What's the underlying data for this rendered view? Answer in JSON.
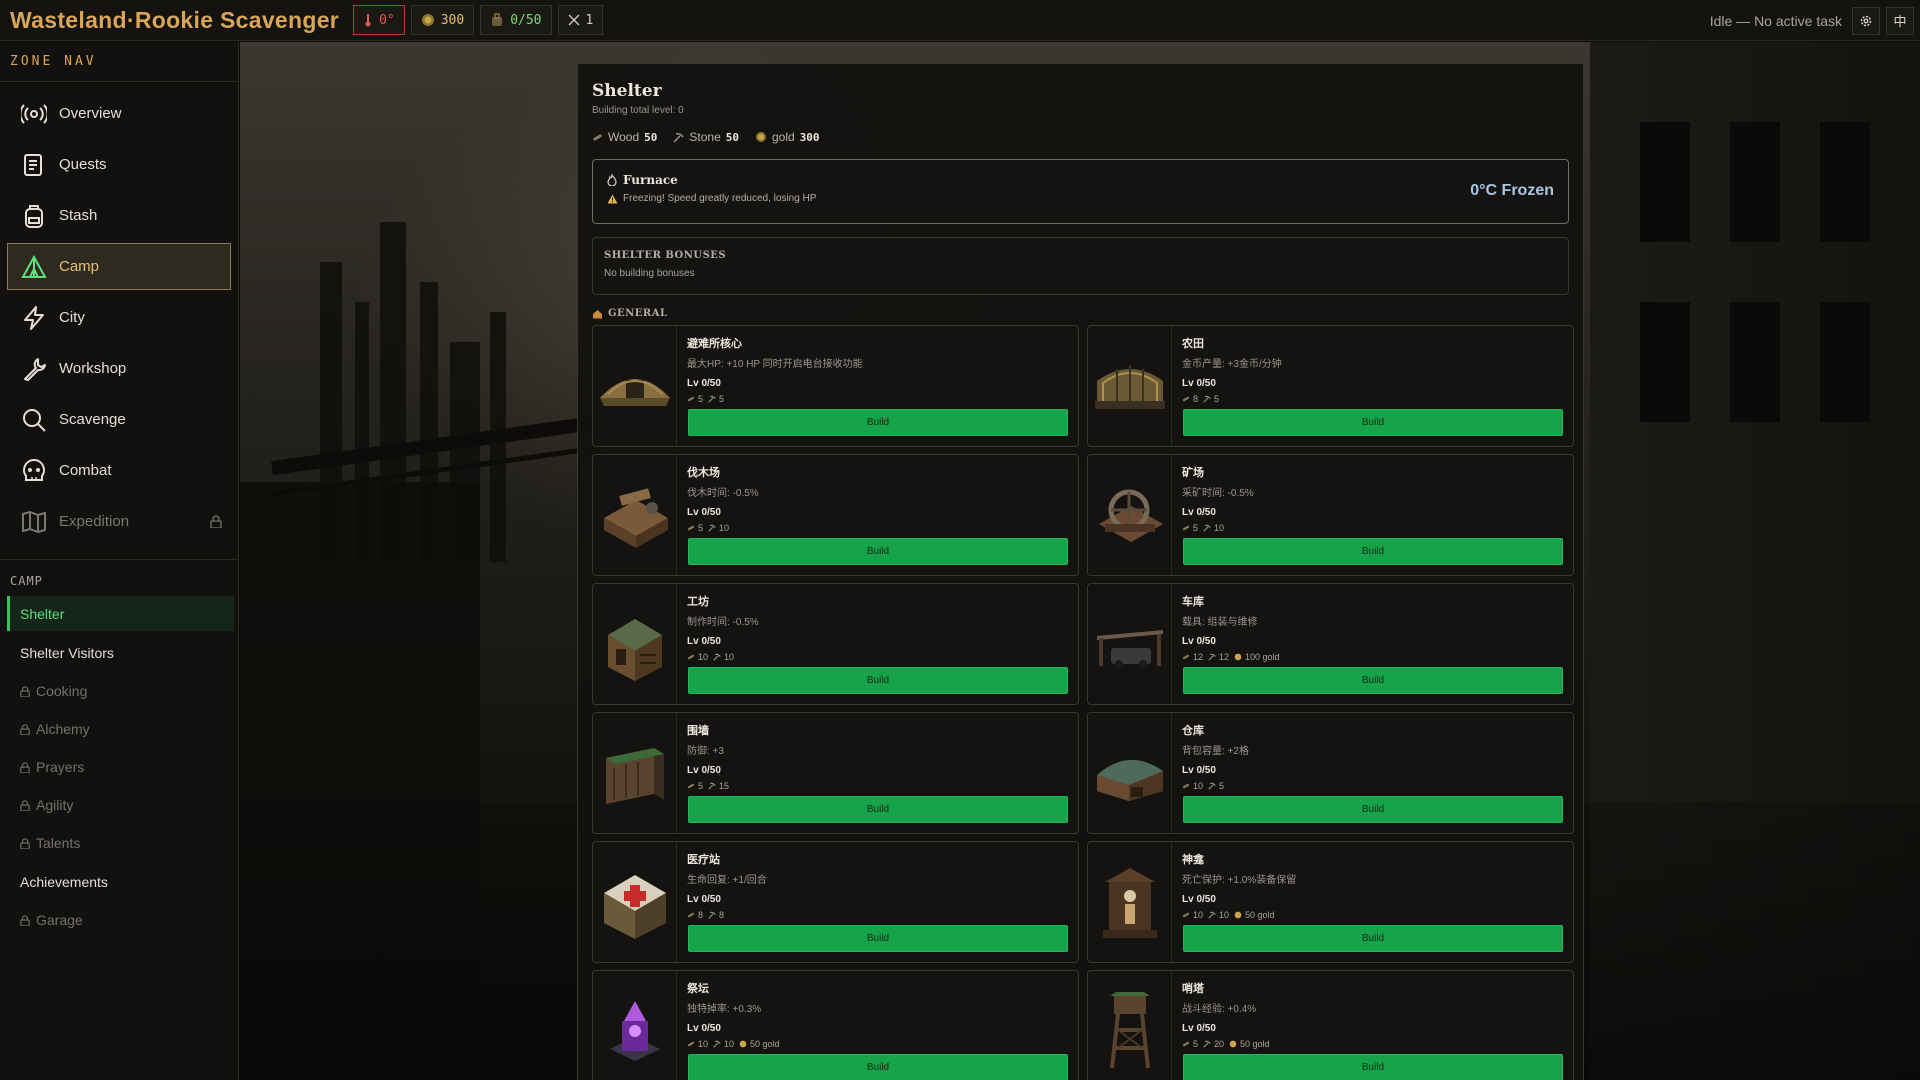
{
  "topbar": {
    "title": "Wasteland·Rookie Scavenger",
    "temperature": "0°",
    "gold": "300",
    "capacity": "0/50",
    "attack": "1",
    "status": "Idle — No active task",
    "lang_button": "中"
  },
  "sidebar": {
    "section_label": "ZONE NAV",
    "items": [
      {
        "label": "Overview",
        "icon": "radio-icon"
      },
      {
        "label": "Quests",
        "icon": "scroll-icon"
      },
      {
        "label": "Stash",
        "icon": "backpack-icon"
      },
      {
        "label": "Camp",
        "icon": "tent-icon"
      },
      {
        "label": "City",
        "icon": "bolt-icon"
      },
      {
        "label": "Workshop",
        "icon": "wrench-icon"
      },
      {
        "label": "Scavenge",
        "icon": "search-icon"
      },
      {
        "label": "Combat",
        "icon": "skull-icon"
      },
      {
        "label": "Expedition",
        "icon": "map-icon"
      }
    ],
    "camp_label": "CAMP",
    "camp_items": [
      {
        "label": "Shelter"
      },
      {
        "label": "Shelter Visitors"
      },
      {
        "label": "Cooking"
      },
      {
        "label": "Alchemy"
      },
      {
        "label": "Prayers"
      },
      {
        "label": "Agility"
      },
      {
        "label": "Talents"
      },
      {
        "label": "Achievements"
      },
      {
        "label": "Garage"
      }
    ]
  },
  "shelter": {
    "title": "Shelter",
    "subtitle": "Building total level: 0",
    "resources": {
      "wood_label": "Wood",
      "wood": "50",
      "stone_label": "Stone",
      "stone": "50",
      "gold_label": "gold",
      "gold": "300"
    },
    "furnace": {
      "name": "Furnace",
      "warning": "Freezing! Speed greatly reduced, losing HP",
      "temperature": "0°C Frozen"
    },
    "bonuses": {
      "title": "SHELTER BONUSES",
      "text": "No building bonuses"
    },
    "general_label": "GENERAL",
    "build_label": "Build",
    "buildings": [
      {
        "name": "避难所核心",
        "desc": "最大HP: +10 HP 同时开启电台接收功能",
        "level": "Lv 0/50",
        "wood": "5",
        "stone": "5",
        "gold": ""
      },
      {
        "name": "农田",
        "desc": "金币产量: +3金币/分钟",
        "level": "Lv 0/50",
        "wood": "8",
        "stone": "5",
        "gold": ""
      },
      {
        "name": "伐木场",
        "desc": "伐木时间: -0.5%",
        "level": "Lv 0/50",
        "wood": "5",
        "stone": "10",
        "gold": ""
      },
      {
        "name": "矿场",
        "desc": "采矿时间: -0.5%",
        "level": "Lv 0/50",
        "wood": "5",
        "stone": "10",
        "gold": ""
      },
      {
        "name": "工坊",
        "desc": "制作时间: -0.5%",
        "level": "Lv 0/50",
        "wood": "10",
        "stone": "10",
        "gold": ""
      },
      {
        "name": "车库",
        "desc": "载具: 组装与维修",
        "level": "Lv 0/50",
        "wood": "12",
        "stone": "12",
        "gold": "100 gold"
      },
      {
        "name": "围墙",
        "desc": "防御: +3",
        "level": "Lv 0/50",
        "wood": "5",
        "stone": "15",
        "gold": ""
      },
      {
        "name": "仓库",
        "desc": "背包容量: +2格",
        "level": "Lv 0/50",
        "wood": "10",
        "stone": "5",
        "gold": ""
      },
      {
        "name": "医疗站",
        "desc": "生命回复: +1/回合",
        "level": "Lv 0/50",
        "wood": "8",
        "stone": "8",
        "gold": ""
      },
      {
        "name": "神龛",
        "desc": "死亡保护: +1.0%装备保留",
        "level": "Lv 0/50",
        "wood": "10",
        "stone": "10",
        "gold": "50 gold"
      },
      {
        "name": "祭坛",
        "desc": "独特掉率: +0.3%",
        "level": "Lv 0/50",
        "wood": "10",
        "stone": "10",
        "gold": "50 gold"
      },
      {
        "name": "哨塔",
        "desc": "战斗经验: +0.4%",
        "level": "Lv 0/50",
        "wood": "5",
        "stone": "20",
        "gold": "50 gold"
      }
    ]
  },
  "colors": {
    "accent": "#d9a658",
    "build": "#16a34a",
    "active_sub": "#5fe07a",
    "frozen": "#a9c6e3"
  }
}
